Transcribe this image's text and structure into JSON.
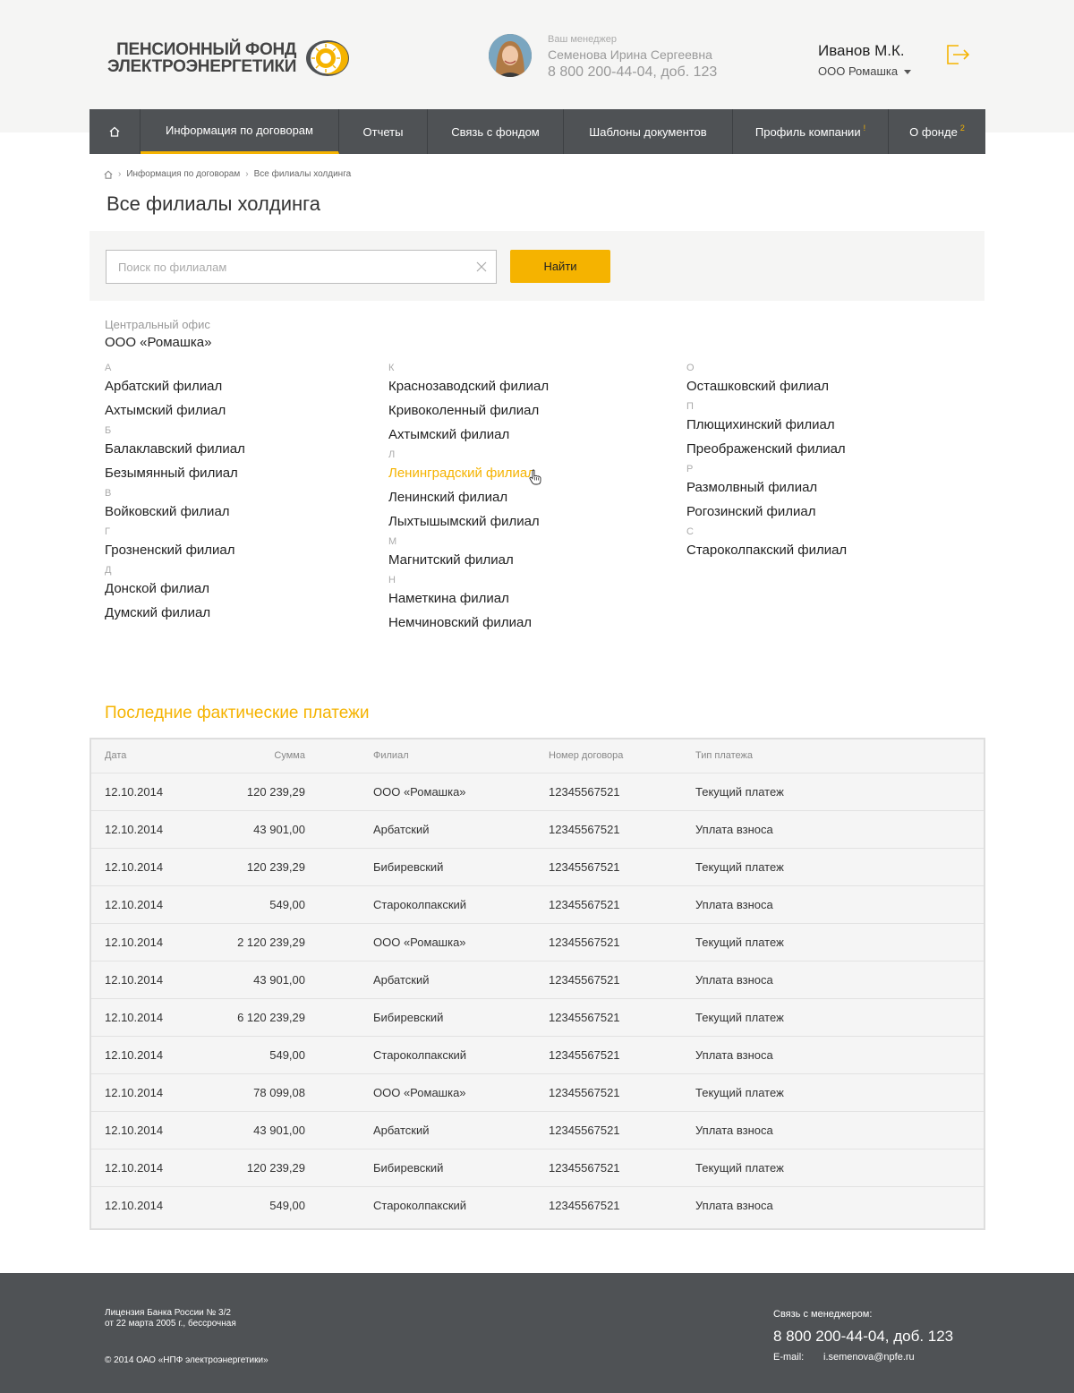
{
  "header": {
    "logo_line1": "ПЕНСИОННЫЙ ФОНД",
    "logo_line2": "ЭЛЕКТРОЭНЕРГЕТИКИ",
    "manager": {
      "caption": "Ваш менеджер",
      "name": "Семенова Ирина Сергеевна",
      "phone": "8 800 200-44-04, доб. 123"
    },
    "user": {
      "name": "Иванов М.К.",
      "company": "ООО Ромашка"
    },
    "icons": {
      "home": "home-icon",
      "logout": "logout-icon",
      "caret": "chevron-down-icon"
    }
  },
  "nav": {
    "items": [
      {
        "label": "Информация по договорам",
        "active": true
      },
      {
        "label": "Отчеты"
      },
      {
        "label": "Связь с фондом"
      },
      {
        "label": "Шаблоны документов"
      },
      {
        "label": "Профиль компании",
        "badge": "!"
      },
      {
        "label": "О фонде",
        "badge": "2"
      }
    ]
  },
  "breadcrumbs": [
    "Информация по договорам",
    "Все филиалы холдинга"
  ],
  "page_title": "Все филиалы холдинга",
  "search": {
    "placeholder": "Поиск по филиалам",
    "value": "",
    "button": "Найти"
  },
  "central_office": {
    "caption": "Центральный офис",
    "name": "ООО «Ромашка»"
  },
  "branches": {
    "col1": [
      {
        "letter": "А",
        "items": [
          "Арбатский филиал",
          "Ахтымский филиал"
        ]
      },
      {
        "letter": "Б",
        "items": [
          "Балаклавский филиал",
          "Безымянный филиал"
        ]
      },
      {
        "letter": "В",
        "items": [
          "Войковский филиал"
        ]
      },
      {
        "letter": "Г",
        "items": [
          "Грозненский филиал"
        ]
      },
      {
        "letter": "Д",
        "items": [
          "Донской филиал",
          "Думский филиал"
        ]
      }
    ],
    "col2": [
      {
        "letter": "К",
        "items": [
          "Краснозаводский филиал",
          "Кривоколенный филиал",
          "Ахтымский филиал"
        ]
      },
      {
        "letter": "Л",
        "items": [
          "Ленинградский филиал",
          "Ленинский филиал",
          "Лыхтышымский филиал"
        ]
      },
      {
        "letter": "М",
        "items": [
          "Магнитский филиал"
        ]
      },
      {
        "letter": "Н",
        "items": [
          "Наметкина филиал",
          "Немчиновский филиал"
        ]
      }
    ],
    "col3": [
      {
        "letter": "О",
        "items": [
          "Осташковский филиал"
        ]
      },
      {
        "letter": "П",
        "items": [
          "Плющихинский филиал",
          "Преображенский филиал"
        ]
      },
      {
        "letter": "Р",
        "items": [
          "Размолвный филиал",
          "Рогозинский филиал"
        ]
      },
      {
        "letter": "С",
        "items": [
          "Староколпакский филиал"
        ]
      }
    ],
    "hovered": "Ленинградский филиал"
  },
  "payments": {
    "title": "Последние фактические платежи",
    "columns": [
      "Дата",
      "Сумма",
      "Филиал",
      "Номер договора",
      "Тип платежа"
    ],
    "rows": [
      [
        "12.10.2014",
        "120 239,29",
        "ООО «Ромашка»",
        "12345567521",
        "Текущий платеж"
      ],
      [
        "12.10.2014",
        "43 901,00",
        "Арбатский",
        "12345567521",
        "Уплата взноса"
      ],
      [
        "12.10.2014",
        "120 239,29",
        "Бибиревский",
        "12345567521",
        "Текущий платеж"
      ],
      [
        "12.10.2014",
        "549,00",
        "Староколпакский",
        "12345567521",
        "Уплата взноса"
      ],
      [
        "12.10.2014",
        "2 120 239,29",
        "ООО «Ромашка»",
        "12345567521",
        "Текущий платеж"
      ],
      [
        "12.10.2014",
        "43 901,00",
        "Арбатский",
        "12345567521",
        "Уплата взноса"
      ],
      [
        "12.10.2014",
        "6 120 239,29",
        "Бибиревский",
        "12345567521",
        "Текущий платеж"
      ],
      [
        "12.10.2014",
        "549,00",
        "Староколпакский",
        "12345567521",
        "Уплата взноса"
      ],
      [
        "12.10.2014",
        "78 099,08",
        "ООО «Ромашка»",
        "12345567521",
        "Текущий платеж"
      ],
      [
        "12.10.2014",
        "43 901,00",
        "Арбатский",
        "12345567521",
        "Уплата взноса"
      ],
      [
        "12.10.2014",
        "120 239,29",
        "Бибиревский",
        "12345567521",
        "Текущий платеж"
      ],
      [
        "12.10.2014",
        "549,00",
        "Староколпакский",
        "12345567521",
        "Уплата взноса"
      ]
    ]
  },
  "footer": {
    "license_line1": "Лицензия Банка России № 3/2",
    "license_line2": "от 22 марта 2005 г., бессрочная",
    "copyright": "© 2014 ОАО «НПФ электроэнергетики»",
    "contact_caption": "Связь с менеджером:",
    "contact_phone": "8 800 200-44-04, доб. 123",
    "email_label": "E-mail:",
    "email": "i.semenova@npfe.ru"
  },
  "colors": {
    "accent": "#f5b300",
    "nav_bg": "#4f5255",
    "footer_bg": "#4f5255",
    "header_bg": "#f5f5f4"
  }
}
